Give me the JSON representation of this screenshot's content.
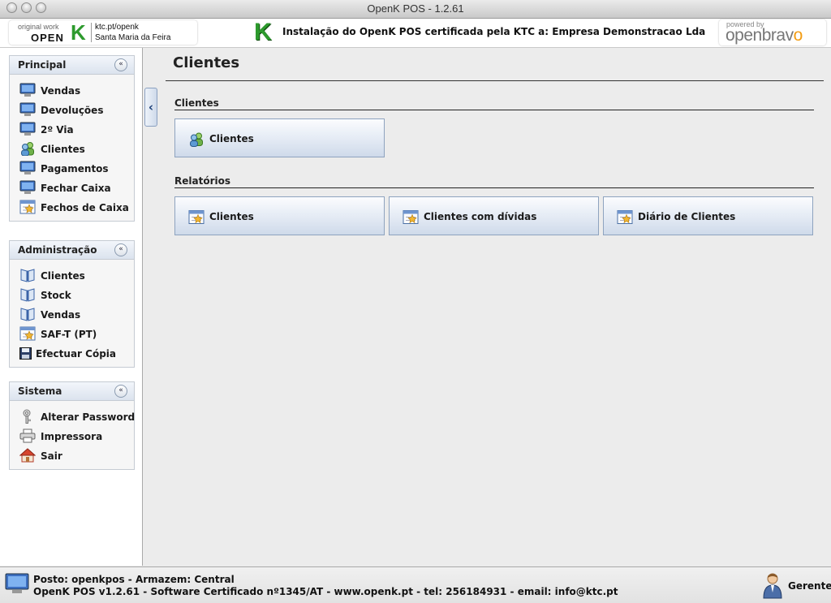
{
  "window": {
    "title": "OpenK POS - 1.2.61"
  },
  "header": {
    "logo": {
      "original": "original work",
      "open": "OPEN",
      "k": "K",
      "url": "ktc.pt/openk",
      "location": "Santa Maria da Feira"
    },
    "k_glyph": "K",
    "certification": "Instalação do OpenK POS certificada pela KTC a: Empresa Demonstracao Lda",
    "openbravo": {
      "powered": "powered by",
      "brand_start": "openbrav",
      "brand_end": "o"
    }
  },
  "sidebar": {
    "groups": [
      {
        "title": "Principal",
        "items": [
          {
            "label": "Vendas",
            "icon": "monitor"
          },
          {
            "label": "Devoluções",
            "icon": "monitor"
          },
          {
            "label": "2º Via",
            "icon": "monitor"
          },
          {
            "label": "Clientes",
            "icon": "users"
          },
          {
            "label": "Pagamentos",
            "icon": "monitor"
          },
          {
            "label": "Fechar Caixa",
            "icon": "monitor"
          },
          {
            "label": "Fechos de Caixa",
            "icon": "report"
          }
        ]
      },
      {
        "title": "Administração",
        "items": [
          {
            "label": "Clientes",
            "icon": "book"
          },
          {
            "label": "Stock",
            "icon": "book"
          },
          {
            "label": "Vendas",
            "icon": "book"
          },
          {
            "label": "SAF-T (PT)",
            "icon": "report"
          },
          {
            "label": "Efectuar Cópia",
            "icon": "floppy"
          }
        ]
      },
      {
        "title": "Sistema",
        "items": [
          {
            "label": "Alterar Password",
            "icon": "key"
          },
          {
            "label": "Impressora",
            "icon": "printer"
          },
          {
            "label": "Sair",
            "icon": "home"
          }
        ]
      }
    ],
    "collapse_glyph": "«",
    "toggle_glyph": "‹"
  },
  "main": {
    "title": "Clientes",
    "sections": [
      {
        "label": "Clientes",
        "buttons": [
          {
            "label": "Clientes",
            "icon": "users"
          }
        ]
      },
      {
        "label": "Relatórios",
        "buttons": [
          {
            "label": "Clientes",
            "icon": "report"
          },
          {
            "label": "Clientes com dívidas",
            "icon": "report"
          },
          {
            "label": "Diário de Clientes",
            "icon": "report"
          }
        ]
      }
    ]
  },
  "status": {
    "line1": "Posto: openkpos - Armazem: Central",
    "line2": "OpenK POS v1.2.61 - Software Certificado nº1345/AT - www.openk.pt - tel: 256184931 - email: info@ktc.pt",
    "user": "Gerente"
  },
  "colors": {
    "accent_green": "#2d9a2d",
    "button_border": "#8ea3bf",
    "openbravo_orange": "#f39c12"
  }
}
